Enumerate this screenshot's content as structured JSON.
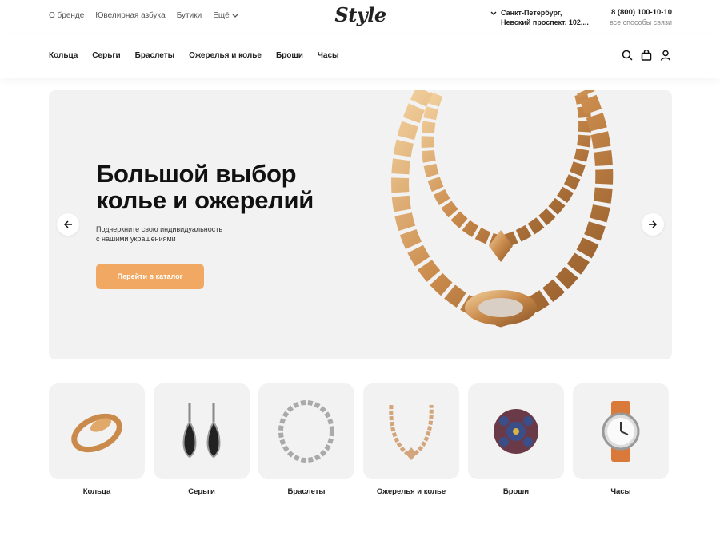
{
  "topbar": {
    "links": [
      "О бренде",
      "Ювелирная азбука",
      "Бутики"
    ],
    "more_label": "Ещё",
    "logo": "Style",
    "address_line1": "Санкт-Петербург,",
    "address_line2": "Невский проспект, 102,...",
    "phone": "8 (800) 100-10-10",
    "contacts_label": "все способы связи"
  },
  "nav": {
    "items": [
      "Кольца",
      "Серьги",
      "Браслеты",
      "Ожерелья и колье",
      "Броши",
      "Часы"
    ],
    "icons": [
      "search-icon",
      "bag-icon",
      "user-icon"
    ]
  },
  "hero": {
    "title_line1": "Большой выбор",
    "title_line2": "колье и ожерелий",
    "subtitle_line1": "Подчеркните свою индивидуальность",
    "subtitle_line2": "с нашими украшениями",
    "button_label": "Перейти в каталог",
    "accent_color": "#f0a863"
  },
  "categories": [
    {
      "label": "Кольца",
      "icon": "ring-icon"
    },
    {
      "label": "Серьги",
      "icon": "earrings-icon"
    },
    {
      "label": "Браслеты",
      "icon": "bracelet-icon"
    },
    {
      "label": "Ожерелья и колье",
      "icon": "necklace-icon"
    },
    {
      "label": "Броши",
      "icon": "brooch-icon"
    },
    {
      "label": "Часы",
      "icon": "watch-icon"
    }
  ]
}
